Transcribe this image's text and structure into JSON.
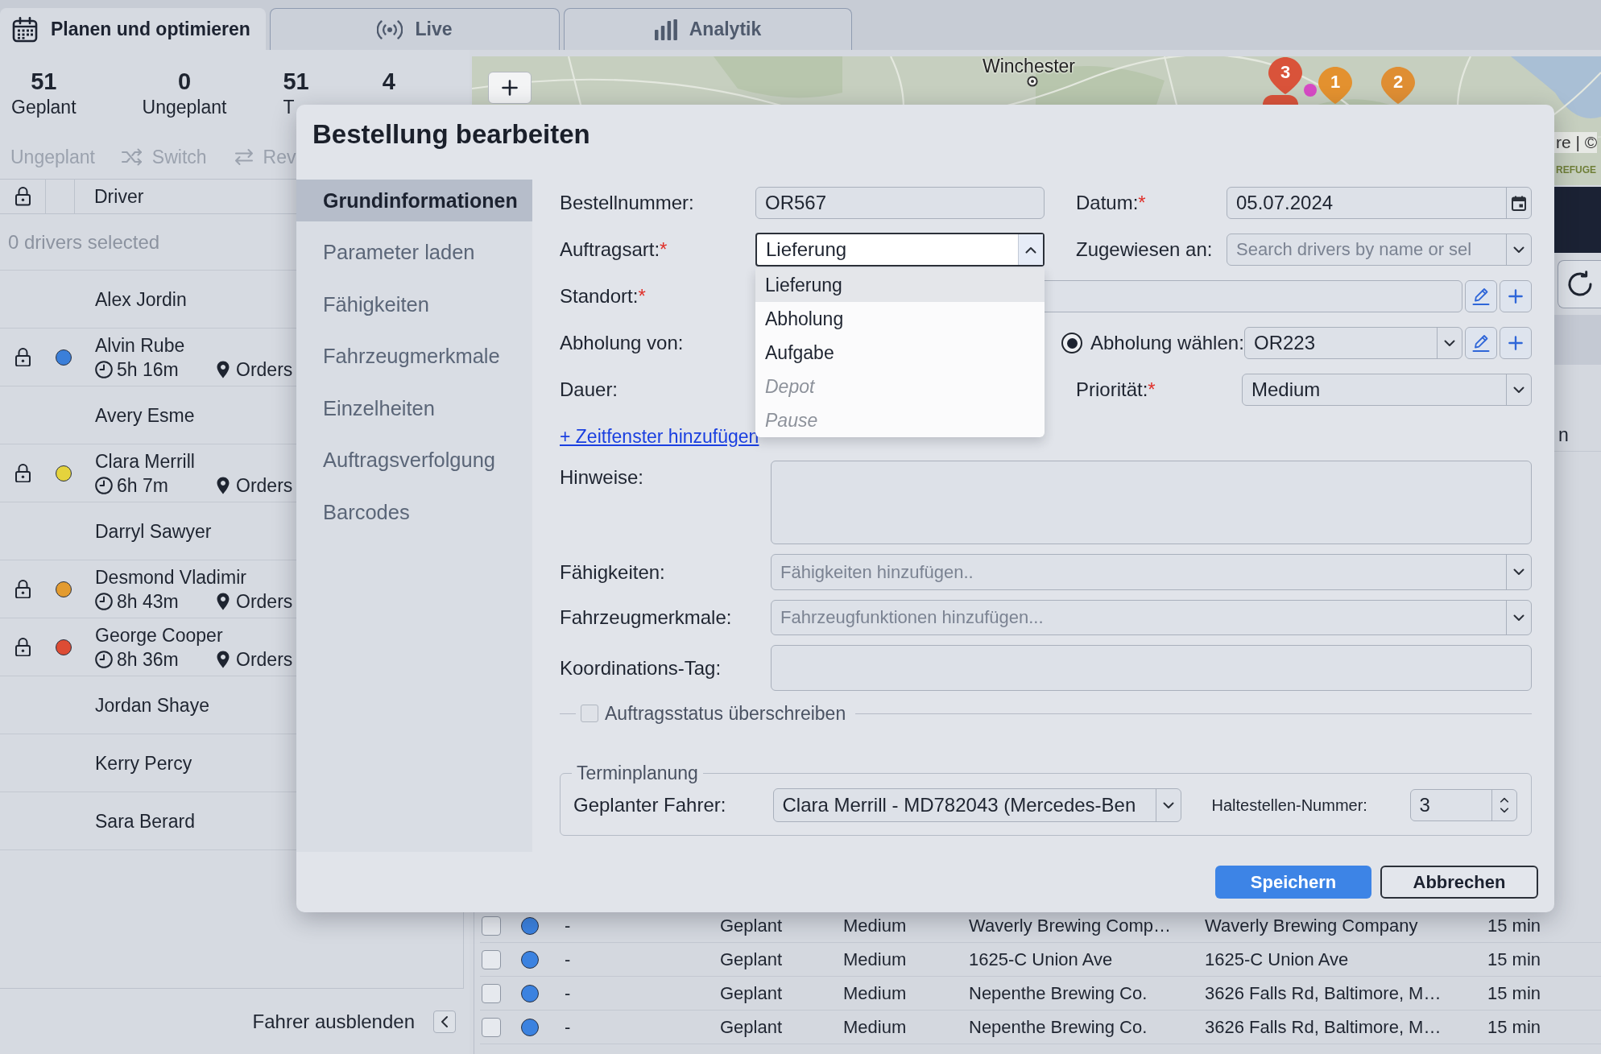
{
  "tabs": [
    {
      "label": "Planen und optimieren",
      "selected": true
    },
    {
      "label": "Live",
      "selected": false
    },
    {
      "label": "Analytik",
      "selected": false
    }
  ],
  "stats": [
    {
      "value": "51",
      "label": "Geplant"
    },
    {
      "value": "0",
      "label": "Ungeplant"
    },
    {
      "value": "51",
      "label": "T"
    },
    {
      "value": "4"
    }
  ],
  "toolbar": [
    {
      "label": "Ungeplant",
      "disabled": true
    },
    {
      "label": "Switch",
      "disabled": true
    },
    {
      "label": "Rev",
      "disabled": true
    }
  ],
  "drivers": {
    "header": "Driver",
    "selection_note": "0 drivers selected",
    "list": [
      {
        "kind": "idle",
        "name": "Alex Jordin"
      },
      {
        "kind": "route",
        "name": "Alvin Rube",
        "color": "#3b7fd9",
        "duration": "5h 16m",
        "orders": "Orders"
      },
      {
        "kind": "idle",
        "name": "Avery Esme"
      },
      {
        "kind": "route",
        "name": "Clara Merrill",
        "color": "#e5d33d",
        "duration": "6h 7m",
        "orders": "Orders"
      },
      {
        "kind": "idle",
        "name": "Darryl Sawyer"
      },
      {
        "kind": "route",
        "name": "Desmond Vladimir",
        "color": "#e39b2f",
        "duration": "8h 43m",
        "orders": "Orders"
      },
      {
        "kind": "route",
        "name": "George Cooper",
        "color": "#dd4c34",
        "duration": "8h 36m",
        "orders": "Orders"
      },
      {
        "kind": "idle",
        "name": "Jordan Shaye"
      },
      {
        "kind": "idle",
        "name": "Kerry Percy"
      },
      {
        "kind": "idle",
        "name": "Sara Berard"
      }
    ],
    "hide_label": "Fahrer ausblenden"
  },
  "map": {
    "place_label": "Winchester",
    "markers": [
      {
        "kind": "pin",
        "color": "#d9533a"
      },
      {
        "kind": "pin",
        "label": "3",
        "color": "#d9533a"
      },
      {
        "kind": "dot",
        "color": "#d64bc4"
      },
      {
        "kind": "pin",
        "label": "1",
        "color": "#e3912f"
      },
      {
        "kind": "pin",
        "label": "2",
        "color": "#df8e33"
      }
    ],
    "attribution": "re | ©",
    "area_label": "REFUGE"
  },
  "side_strip": {
    "text": "n"
  },
  "orders": {
    "rows": [
      {
        "checked": false,
        "color": "#3b82e0",
        "cells": [
          "-",
          "Geplant",
          "Medium",
          "Waverly Brewing Comp…",
          "Waverly Brewing Company",
          "15 min"
        ]
      },
      {
        "checked": false,
        "color": "#3b82e0",
        "cells": [
          "-",
          "Geplant",
          "Medium",
          "1625-C Union Ave",
          "1625-C Union Ave",
          "15 min"
        ]
      },
      {
        "checked": false,
        "color": "#3b82e0",
        "cells": [
          "-",
          "Geplant",
          "Medium",
          "Nepenthe Brewing Co.",
          "3626 Falls Rd, Baltimore, M…",
          "15 min"
        ]
      },
      {
        "checked": false,
        "color": "#3b82e0",
        "cells": [
          "-",
          "Geplant",
          "Medium",
          "Nepenthe Brewing Co.",
          "3626 Falls Rd, Baltimore, M…",
          "15 min"
        ]
      }
    ]
  },
  "modal": {
    "title": "Bestellung bearbeiten",
    "nav": [
      {
        "label": "Grundinformationen",
        "selected": true
      },
      {
        "label": "Parameter laden",
        "selected": false
      },
      {
        "label": "Fähigkeiten",
        "selected": false
      },
      {
        "label": "Fahrzeugmerkmale",
        "selected": false
      },
      {
        "label": "Einzelheiten",
        "selected": false
      },
      {
        "label": "Auftragsverfolgung",
        "selected": false
      },
      {
        "label": "Barcodes",
        "selected": false
      }
    ],
    "order_number": {
      "label": "Bestellnummer:",
      "value": "OR567"
    },
    "date": {
      "label": "Datum:",
      "required_mark": "*",
      "value": "05.07.2024"
    },
    "order_type": {
      "label": "Auftragsart:",
      "required_mark": "*",
      "value": "Lieferung",
      "expanded": true,
      "options": [
        {
          "label": "Lieferung",
          "selected": true,
          "disabled": false
        },
        {
          "label": "Abholung",
          "selected": false,
          "disabled": false
        },
        {
          "label": "Aufgabe",
          "selected": false,
          "disabled": false
        },
        {
          "label": "Depot",
          "selected": false,
          "disabled": true
        },
        {
          "label": "Pause",
          "selected": false,
          "disabled": true
        }
      ]
    },
    "assigned_to": {
      "label": "Zugewiesen an:",
      "placeholder": "Search drivers by name or sel"
    },
    "location": {
      "label": "Standort:",
      "required_mark": "*"
    },
    "pickup_from": {
      "label": "Abholung von:"
    },
    "pickup_select": {
      "label": "Abholung wählen:",
      "checked": true,
      "value": "OR223"
    },
    "duration": {
      "label": "Dauer:"
    },
    "priority": {
      "label": "Priorität:",
      "required_mark": "*",
      "value": "Medium"
    },
    "time_window_link": "+ Zeitfenster hinzufügen",
    "notes": {
      "label": "Hinweise:"
    },
    "skills": {
      "label": "Fähigkeiten:",
      "placeholder": "Fähigkeiten hinzufügen.."
    },
    "vehicle_features": {
      "label": "Fahrzeugmerkmale:",
      "placeholder": "Fahrzeugfunktionen hinzufügen..."
    },
    "coordination_tag": {
      "label": "Koordinations-Tag:"
    },
    "override_status": {
      "label": "Auftragsstatus überschreiben",
      "checked": false
    },
    "scheduling": {
      "legend": "Terminplanung",
      "driver": {
        "label": "Geplanter Fahrer:",
        "value": "Clara Merrill - MD782043 (Mercedes-Ben"
      },
      "stop_number": {
        "label": "Haltestellen-Nummer:",
        "value": "3"
      }
    },
    "buttons": [
      {
        "label": "Speichern",
        "kind": "primary"
      },
      {
        "label": "Abbrechen",
        "kind": "secondary"
      }
    ]
  }
}
